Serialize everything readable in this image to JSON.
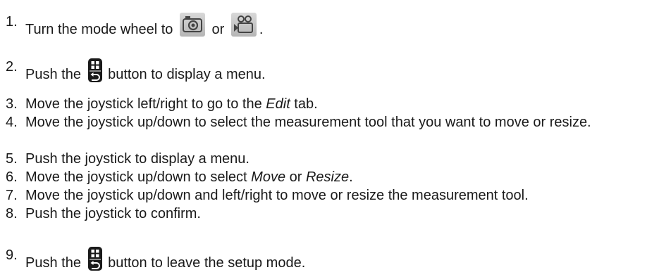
{
  "steps": [
    {
      "num": "1.",
      "text_a": "Turn the mode wheel to ",
      "text_b": " or ",
      "text_c": ".",
      "icons": [
        "photo-mode-icon",
        "video-mode-icon"
      ]
    },
    {
      "num": "2.",
      "text_a": "Push the ",
      "text_b": " button to display a menu.",
      "icons": [
        "menu-back-button-icon"
      ]
    },
    {
      "num": "3.",
      "text_a": "Move the joystick left/right to go to the ",
      "em": "Edit",
      "text_b": " tab."
    },
    {
      "num": "4.",
      "text": "Move the joystick up/down to select the measurement tool that you want to move or resize."
    },
    {
      "num": "5.",
      "text": "Push the joystick to display a menu."
    },
    {
      "num": "6.",
      "text_a": "Move the joystick up/down to select ",
      "em_a": "Move",
      "text_b": " or ",
      "em_b": "Resize",
      "text_c": "."
    },
    {
      "num": "7.",
      "text": "Move the joystick up/down and left/right to move or resize the measurement tool."
    },
    {
      "num": "8.",
      "text": "Push the joystick to confirm."
    },
    {
      "num": "9.",
      "text_a": "Push the ",
      "text_b": " button to leave the setup mode.",
      "icons": [
        "menu-back-button-icon"
      ]
    }
  ]
}
